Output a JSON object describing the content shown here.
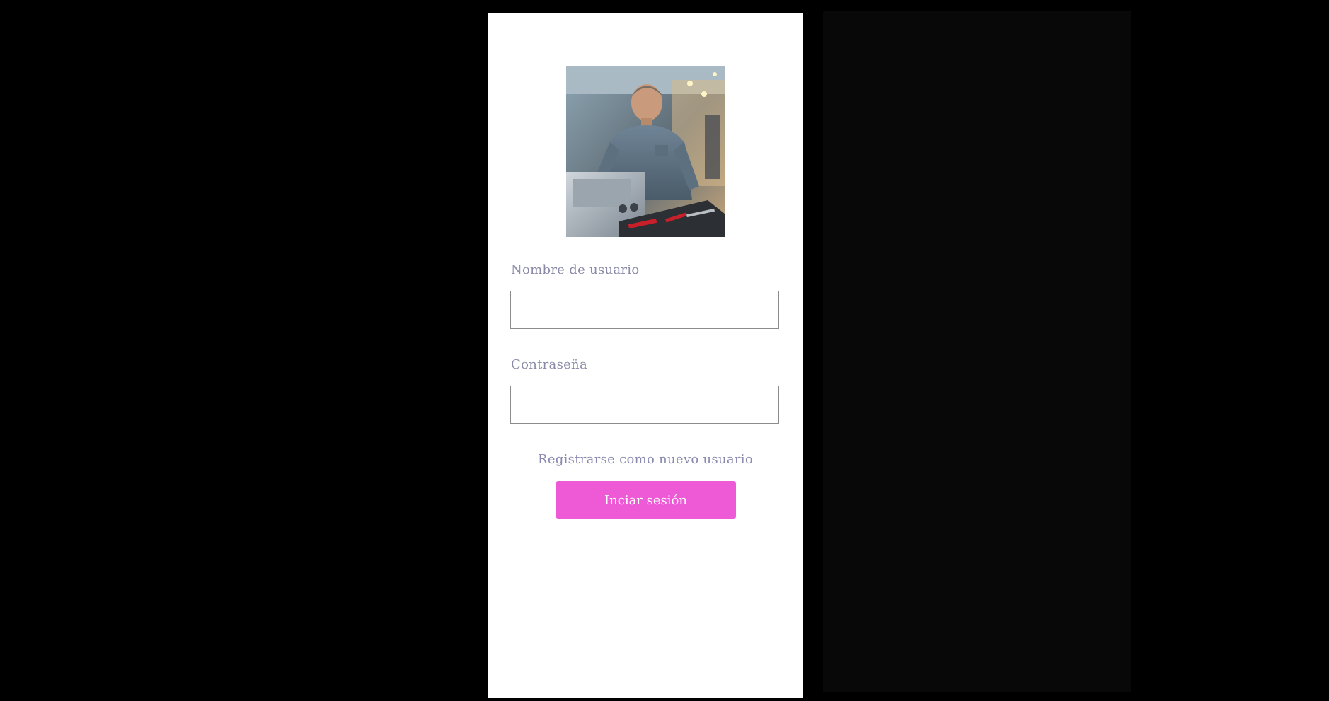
{
  "form": {
    "username_label": "Nombre de usuario",
    "username_value": "",
    "password_label": "Contraseña",
    "password_value": "",
    "register_link": "Registrarse como nuevo usuario",
    "login_button": "Inciar sesión"
  },
  "colors": {
    "accent": "#ee5ad6",
    "label_text": "#8a8aa8",
    "link_text": "#8a8ab0",
    "background": "#000000",
    "panel": "#ffffff"
  },
  "images": {
    "avatar_icon": "technician-photo-icon"
  }
}
